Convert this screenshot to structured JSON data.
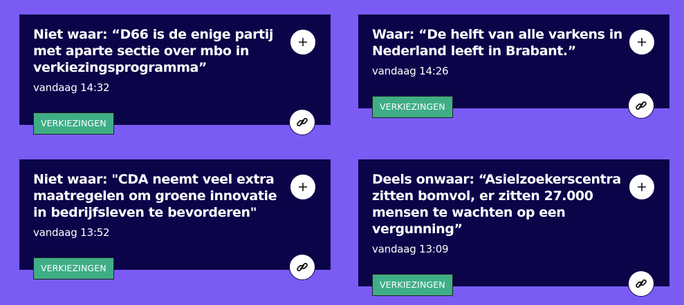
{
  "cards": [
    {
      "title": "Niet waar: “D66 is de enige partij met aparte sectie over mbo in verkiezingsprogramma”",
      "time": "vandaag 14:32",
      "tag": "VERKIEZINGEN"
    },
    {
      "title": "Waar: “De helft van alle varkens in Nederland leeft in Brabant.”",
      "time": "vandaag 14:26",
      "tag": "VERKIEZINGEN"
    },
    {
      "title": "Niet waar: \"CDA neemt veel extra maatregelen om groene innovatie in bedrijfsleven te bevorderen\"",
      "time": "vandaag 13:52",
      "tag": "VERKIEZINGEN"
    },
    {
      "title": "Deels onwaar: “Asielzoekerscentra zitten bomvol, er zitten 27.000 mensen te wachten op een vergunning”",
      "time": "vandaag 13:09",
      "tag": "VERKIEZINGEN"
    }
  ],
  "icons": {
    "add": "plus-icon",
    "share": "link-icon"
  },
  "colors": {
    "page_background": "#7a5cf5",
    "card_background": "#0b0449",
    "tag_background": "#3fae86",
    "text": "#ffffff"
  }
}
